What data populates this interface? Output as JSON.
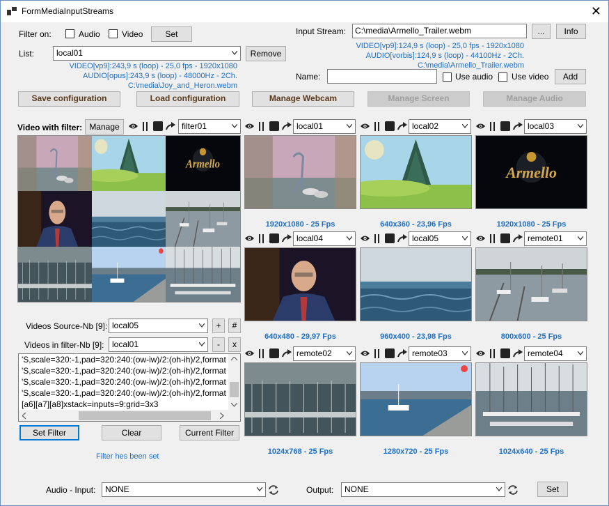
{
  "window": {
    "title": "FormMediaInputStreams",
    "close": "✕"
  },
  "filter": {
    "label": "Filter on:",
    "audio": "Audio",
    "video": "Video",
    "set": "Set"
  },
  "list": {
    "label": "List:",
    "value": "local01",
    "remove": "Remove",
    "info": [
      "VIDEO[vp9]:243,9 s (loop) - 25,0 fps - 1920x1080",
      "AUDIO[opus]:243,9 s (loop) - 48000Hz - 2Ch.",
      "C:\\media\\Joy_and_Heron.webm"
    ]
  },
  "input_stream": {
    "label": "Input Stream:",
    "value": "C:\\media\\Armello_Trailer.webm",
    "browse": "...",
    "info_btn": "Info",
    "info": [
      "VIDEO[vp9]:124,9 s (loop) - 25,0 fps - 1920x1080",
      "AUDIO[vorbis]:124,9 s (loop) - 44100Hz - 2Ch.",
      "C:\\media\\Armello_Trailer.webm"
    ]
  },
  "name": {
    "label": "Name:",
    "value": "",
    "use_audio": "Use audio",
    "use_video": "Use video",
    "add": "Add"
  },
  "toolbar": {
    "save": "Save configuration",
    "load": "Load configuration",
    "webcam": "Manage Webcam",
    "screen": "Manage Screen",
    "audio": "Manage Audio"
  },
  "filter_panel": {
    "title": "Video with filter:",
    "manage": "Manage",
    "selector": "filter01",
    "sources_label": "Videos Source-Nb [9]:",
    "sources_value": "local05",
    "plus": "+",
    "hash": "#",
    "in_filter_label": "Videos in filter-Nb [9]:",
    "in_filter_value": "local01",
    "minus": "-",
    "x": "x",
    "code": [
      "'S,scale=320:-1,pad=320:240:(ow-iw)/2:(oh-ih)/2,format",
      "'S,scale=320:-1,pad=320:240:(ow-iw)/2:(oh-ih)/2,format",
      "'S,scale=320:-1,pad=320:240:(ow-iw)/2:(oh-ih)/2,format",
      "'S,scale=320:-1,pad=320:240:(ow-iw)/2:(oh-ih)/2,format",
      "[a6][a7][a8]xstack=inputs=9:grid=3x3"
    ],
    "set_filter": "Set Filter",
    "clear": "Clear",
    "current_filter": "Current Filter",
    "status": "Filter hes been set"
  },
  "tiles": [
    {
      "source": "local01",
      "caption": "1920x1080 - 25 Fps",
      "scene": "heron"
    },
    {
      "source": "local02",
      "caption": "640x360 - 23,96 Fps",
      "scene": "meadow"
    },
    {
      "source": "local03",
      "caption": "1920x1080 - 25 Fps",
      "scene": "armello"
    },
    {
      "source": "local04",
      "caption": "640x480 - 29,97 Fps",
      "scene": "man"
    },
    {
      "source": "local05",
      "caption": "960x400 - 23,98 Fps",
      "scene": "sea"
    },
    {
      "source": "remote01",
      "caption": "800x600 - 25 Fps",
      "scene": "harbor"
    },
    {
      "source": "remote02",
      "caption": "1024x768 - 25 Fps",
      "scene": "marina"
    },
    {
      "source": "remote03",
      "caption": "1280x720 - 25 Fps",
      "scene": "dock"
    },
    {
      "source": "remote04",
      "caption": "1024x640 - 25 Fps",
      "scene": "boats"
    }
  ],
  "audio_bar": {
    "input_label": "Audio - Input:",
    "input_value": "NONE",
    "output_label": "Output:",
    "output_value": "NONE",
    "set": "Set"
  },
  "armello_text": "Armello",
  "colors": {
    "accent": "#0078d7",
    "info_blue": "#1e6fc8",
    "bold_btn": "#5a3a1a"
  }
}
